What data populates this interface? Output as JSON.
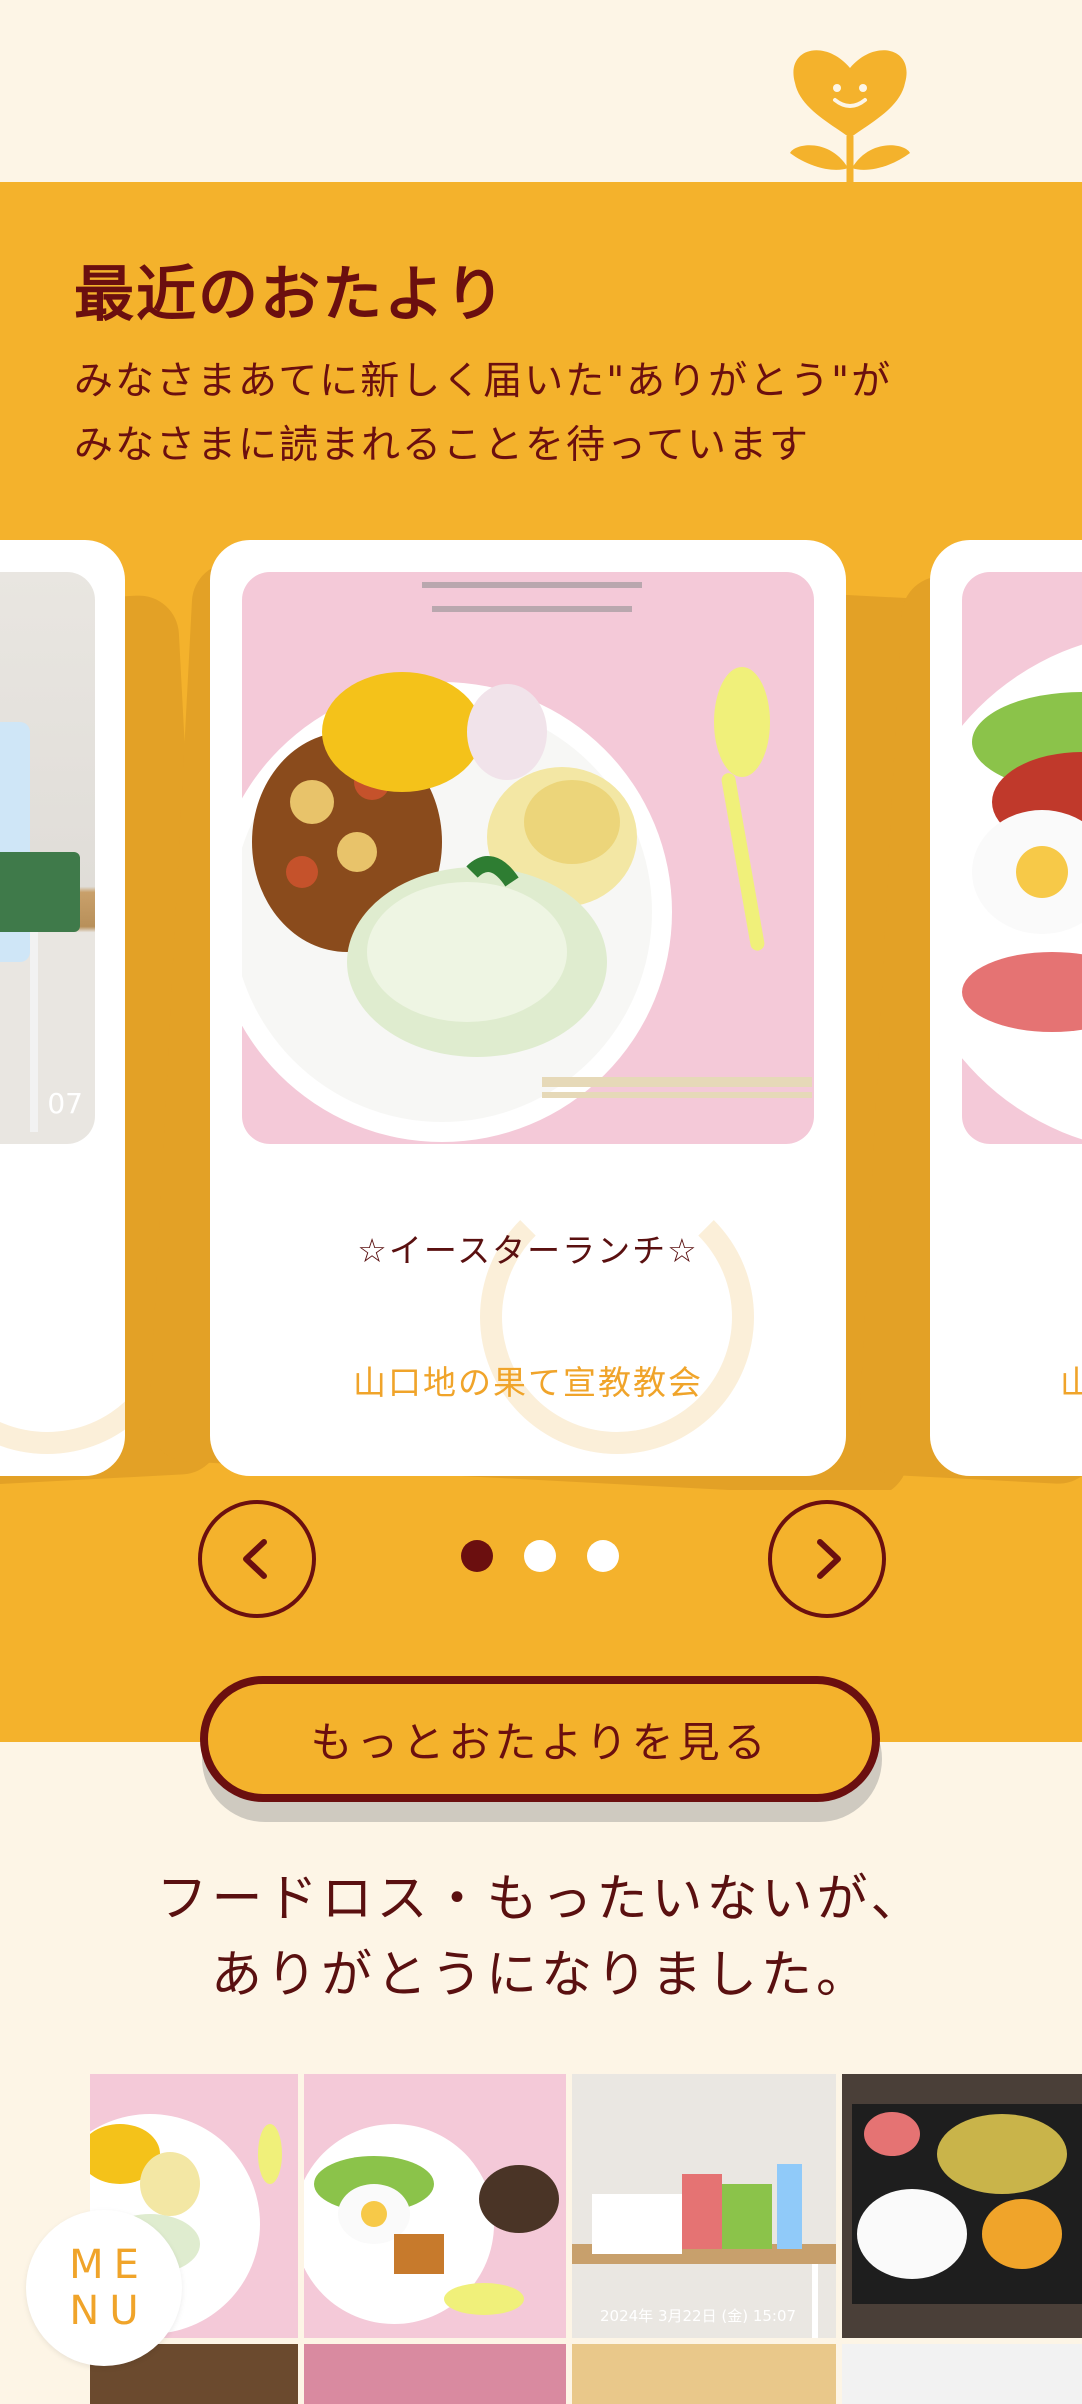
{
  "section": {
    "title": "最近のおたより",
    "description_line1": "みなさまあてに新しく届いた\"ありがとう\"が",
    "description_line2": "みなさまに読まれることを待っています"
  },
  "carousel": {
    "cards": [
      {
        "title": "",
        "author": "",
        "photo_caption": "07"
      },
      {
        "title": "☆イースターランチ☆",
        "author": "山口地の果て宣教教会",
        "photo_caption": ""
      },
      {
        "title": "",
        "author": "山",
        "photo_caption": ""
      }
    ],
    "dots": 3,
    "active_dot": 0,
    "prev_icon": "chevron-left-icon",
    "next_icon": "chevron-right-icon"
  },
  "more_button": {
    "label": "もっとおたよりを見る"
  },
  "tagline": {
    "line1": "フードロス・もったいないが、",
    "line2": "ありがとうになりました。"
  },
  "gallery": {
    "timestamp": "2024年 3月22日 (金) 15:07"
  },
  "menu": {
    "line1": "ME",
    "line2": "NU"
  },
  "colors": {
    "accent_yellow": "#f4b22c",
    "dark_red": "#6b0f0f",
    "cream": "#fdf5e6",
    "author_orange": "#f0a42a"
  }
}
